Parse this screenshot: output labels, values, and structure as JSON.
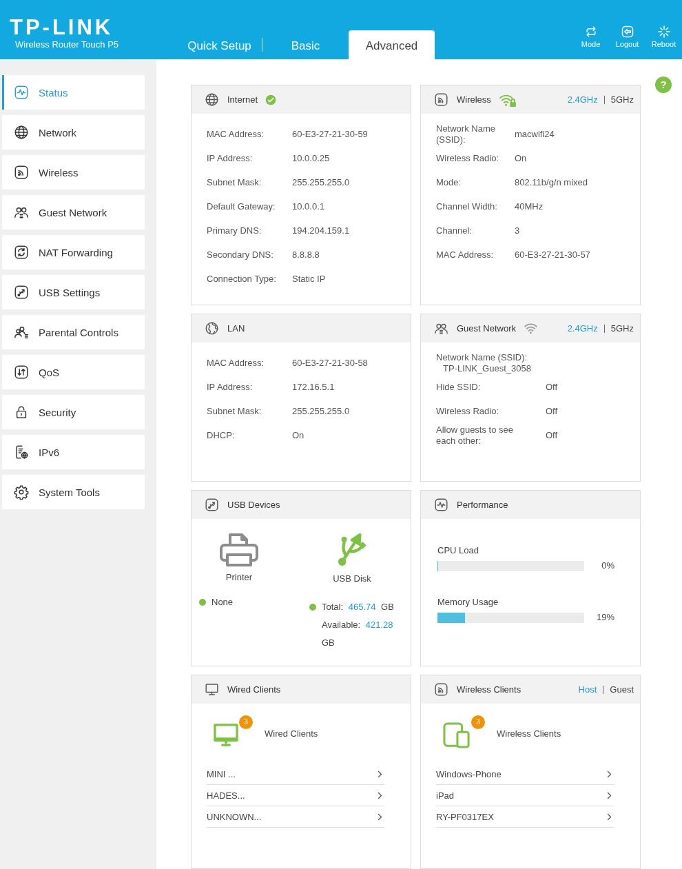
{
  "header": {
    "logo": "TP-LINK",
    "subtitle": "Wireless Router Touch P5",
    "tabs": [
      {
        "label": "Quick Setup",
        "selected": false
      },
      {
        "label": "Basic",
        "selected": false
      },
      {
        "label": "Advanced",
        "selected": true
      }
    ],
    "actions": [
      {
        "kind": "mode",
        "label": "Mode"
      },
      {
        "kind": "logout",
        "label": "Logout"
      },
      {
        "kind": "reboot",
        "label": "Reboot"
      }
    ]
  },
  "sidebar": {
    "items": [
      {
        "kind": "status",
        "label": "Status",
        "selected": true
      },
      {
        "kind": "network",
        "label": "Network",
        "selected": false
      },
      {
        "kind": "wireless",
        "label": "Wireless",
        "selected": false
      },
      {
        "kind": "guest_network",
        "label": "Guest Network",
        "selected": false
      },
      {
        "kind": "nat_forwarding",
        "label": "NAT Forwarding",
        "selected": false
      },
      {
        "kind": "usb_settings",
        "label": "USB Settings",
        "selected": false
      },
      {
        "kind": "parental_controls",
        "label": "Parental Controls",
        "selected": false
      },
      {
        "kind": "qos",
        "label": "QoS",
        "selected": false
      },
      {
        "kind": "security",
        "label": "Security",
        "selected": false
      },
      {
        "kind": "ipv6",
        "label": "IPv6",
        "selected": false
      },
      {
        "kind": "system_tools",
        "label": "System Tools",
        "selected": false
      }
    ]
  },
  "help_button": "?",
  "panels": [
    {
      "kind": "internet",
      "title": "Internet",
      "connected": true,
      "rows": [
        {
          "label": "MAC Address:",
          "value": "60-E3-27-21-30-59"
        },
        {
          "label": "IP Address:",
          "value": "10.0.0.25"
        },
        {
          "label": "Subnet Mask:",
          "value": "255.255.255.0"
        },
        {
          "label": "Default Gateway:",
          "value": "10.0.0.1"
        },
        {
          "label": "Primary DNS:",
          "value": "194.204.159.1"
        },
        {
          "label": "Secondary DNS:",
          "value": "8.8.8.8"
        },
        {
          "label": "Connection Type:",
          "value": "Static IP"
        }
      ]
    },
    {
      "kind": "wireless",
      "title": "Wireless",
      "bands": [
        {
          "label": "2.4GHz",
          "selected": true
        },
        {
          "label": "5GHz",
          "selected": false
        }
      ],
      "rows": [
        {
          "label": "Network Name (SSID):",
          "value": "macwifi24"
        },
        {
          "label": "Wireless Radio:",
          "value": "On"
        },
        {
          "label": "Mode:",
          "value": "802.11b/g/n mixed"
        },
        {
          "label": "Channel Width:",
          "value": "40MHz"
        },
        {
          "label": "Channel:",
          "value": "3"
        },
        {
          "label": "MAC Address:",
          "value": "60-E3-27-21-30-57"
        }
      ]
    },
    {
      "kind": "lan",
      "title": "LAN",
      "rows": [
        {
          "label": "MAC Address:",
          "value": "60-E3-27-21-30-58"
        },
        {
          "label": "IP Address:",
          "value": "172.16.5.1"
        },
        {
          "label": "Subnet Mask:",
          "value": "255.255.255.0"
        },
        {
          "label": "DHCP:",
          "value": "On"
        }
      ]
    },
    {
      "kind": "guest_network",
      "title": "Guest Network",
      "bands": [
        {
          "label": "2.4GHz",
          "selected": true
        },
        {
          "label": "5GHz",
          "selected": false
        }
      ],
      "rows": [
        {
          "kind": "stacked",
          "label": "Network Name (SSID):",
          "value": "TP-LINK_Guest_3058"
        },
        {
          "kind": "inline",
          "label": "Hide SSID:",
          "value": "Off"
        },
        {
          "kind": "inline",
          "label": "Wireless Radio:",
          "value": "Off"
        },
        {
          "kind": "inline",
          "label": "Allow guests to see each other:",
          "value": "Off"
        }
      ]
    },
    {
      "kind": "usb_devices",
      "title": "USB Devices",
      "devices": [
        {
          "kind": "printer",
          "name": "Printer",
          "status": "None"
        },
        {
          "kind": "disk",
          "name": "USB Disk",
          "total_label": "Total:",
          "total": "465.74",
          "total_unit": "GB",
          "available_label": "Available:",
          "available": "421.28",
          "available_unit": "GB"
        }
      ]
    },
    {
      "kind": "performance",
      "title": "Performance",
      "meters": [
        {
          "label": "CPU Load",
          "level": 0,
          "reading": "0%"
        },
        {
          "label": "Memory Usage",
          "level": 0.19,
          "reading": "19%"
        }
      ]
    },
    {
      "kind": "wired_clients",
      "title": "Wired Clients",
      "count": "3",
      "summary": "Wired Clients",
      "clients": [
        "MINI ...",
        "HADES...",
        "UNKNOWN..."
      ]
    },
    {
      "kind": "wireless_clients",
      "title": "Wireless Clients",
      "views": [
        {
          "label": "Host",
          "selected": true
        },
        {
          "label": "Guest",
          "selected": false
        }
      ],
      "count": "3",
      "summary": "Wireless Clients",
      "clients": [
        "Windows-Phone",
        "iPad",
        "RY-PF0317EX"
      ]
    }
  ]
}
